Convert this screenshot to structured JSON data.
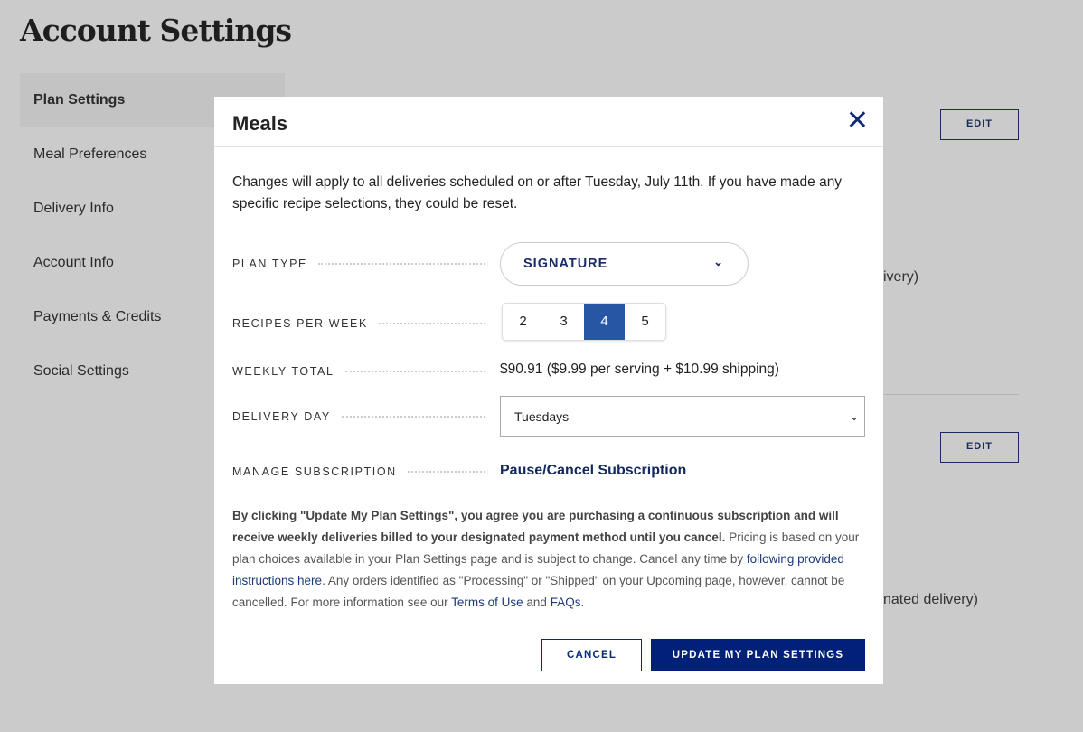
{
  "page": {
    "title": "Account Settings"
  },
  "sidebar": {
    "items": [
      {
        "label": "Plan Settings"
      },
      {
        "label": "Meal Preferences"
      },
      {
        "label": "Delivery Info"
      },
      {
        "label": "Account Info"
      },
      {
        "label": "Payments & Credits"
      },
      {
        "label": "Social Settings"
      }
    ]
  },
  "background": {
    "edit_label": "EDIT",
    "text1": "ivery)",
    "text2": "nated delivery)"
  },
  "modal": {
    "title": "Meals",
    "intro": "Changes will apply to all deliveries scheduled on or after Tuesday, July 11th. If you have made any specific recipe selections, they could be reset.",
    "plan_type_label": "PLAN TYPE",
    "plan_type_value": "SIGNATURE",
    "recipes_label": "RECIPES PER WEEK",
    "recipes_options": [
      "2",
      "3",
      "4",
      "5"
    ],
    "recipes_selected": "4",
    "weekly_total_label": "WEEKLY TOTAL",
    "weekly_total_value": "$90.91 ($9.99 per serving + $10.99 shipping)",
    "delivery_day_label": "DELIVERY DAY",
    "delivery_day_value": "Tuesdays",
    "manage_label": "MANAGE SUBSCRIPTION",
    "manage_link": "Pause/Cancel Subscription",
    "legal": {
      "bold": "By clicking \"Update My Plan Settings\", you agree you are purchasing a continuous subscription and will receive weekly deliveries billed to your designated payment method until you cancel.",
      "t1": " Pricing is based on your plan choices available in your Plan Settings page and is subject to change. Cancel any time by ",
      "link1": "following provided instructions here",
      "t2": ". Any orders identified as \"Processing\" or \"Shipped\" on your Upcoming page, however, cannot be cancelled. For more information see our ",
      "link2": "Terms of Use",
      "t3": " and ",
      "link3": "FAQs",
      "t4": "."
    },
    "cancel_label": "CANCEL",
    "update_label": "UPDATE MY PLAN SETTINGS"
  },
  "colors": {
    "accent": "#002177",
    "selected": "#2756a5"
  }
}
